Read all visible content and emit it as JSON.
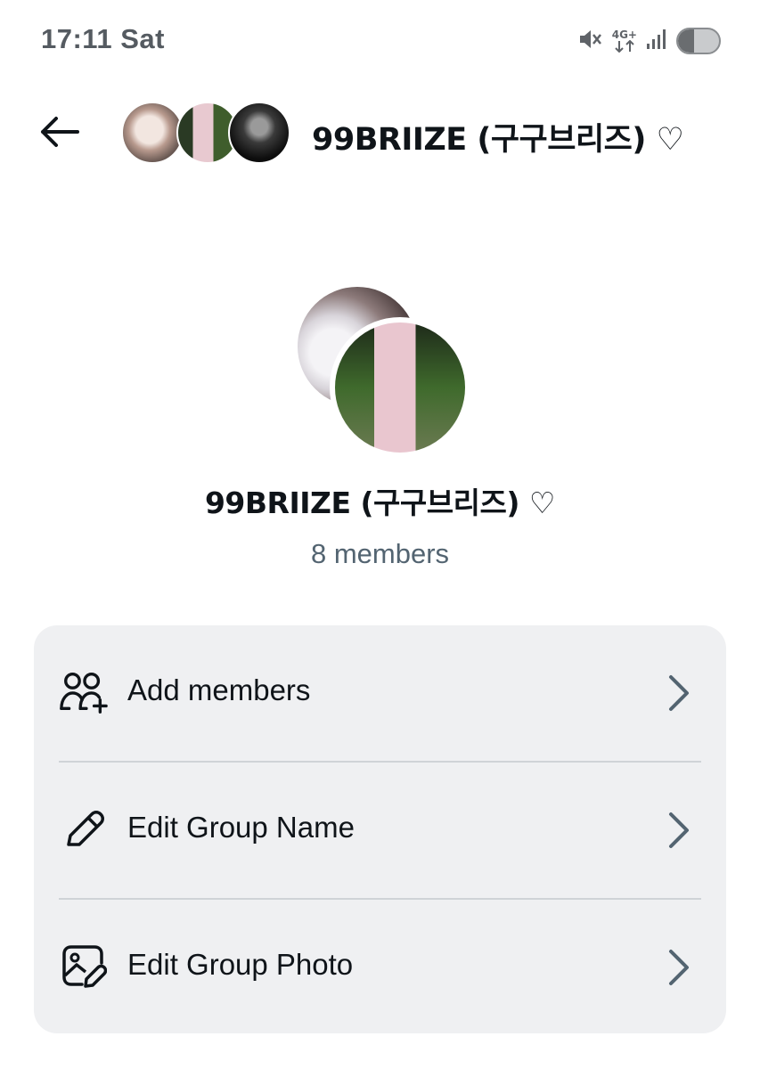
{
  "status_bar": {
    "time": "17:11  Sat",
    "network_label_top": "4G+",
    "icons": [
      "mute-icon",
      "network-4g-icon",
      "signal-icon",
      "battery-icon"
    ]
  },
  "header": {
    "title": "99BRIIZE (구구브리즈) ♡",
    "back_icon": "arrow-left-icon"
  },
  "group": {
    "name": "99BRIIZE (구구브리즈) ♡",
    "member_count": "8 members"
  },
  "actions": [
    {
      "label": "Add members",
      "icon": "add-members-icon"
    },
    {
      "label": "Edit Group Name",
      "icon": "pencil-icon"
    },
    {
      "label": "Edit Group Photo",
      "icon": "edit-photo-icon"
    }
  ],
  "colors": {
    "text_primary": "#0f1419",
    "text_secondary": "#536471",
    "card_bg": "#eff0f2"
  }
}
